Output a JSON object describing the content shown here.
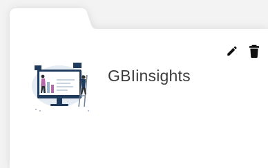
{
  "card": {
    "title": "GBIinsights",
    "thumbnail": "dashboard-illustration",
    "actions": {
      "edit": "edit-icon",
      "delete": "trash-icon"
    }
  },
  "colors": {
    "background": "#f3f3f3",
    "card": "#ffffff",
    "icon": "#111111",
    "title": "#3c3c3c",
    "illustration_dark": "#1f3a5a",
    "illustration_accent": "#b46ba8"
  }
}
